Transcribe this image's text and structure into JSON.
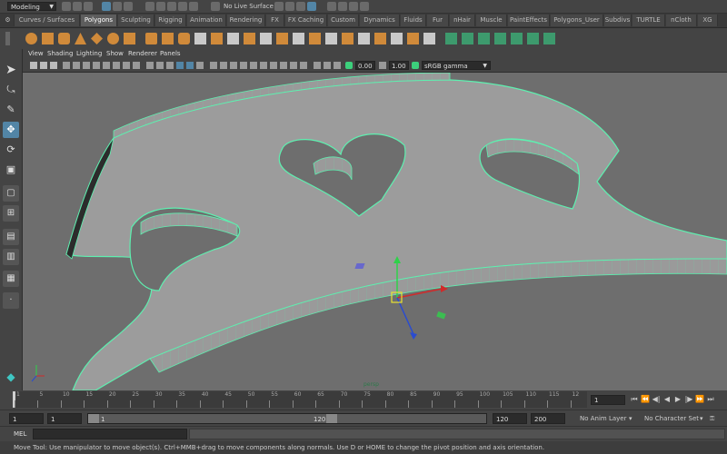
{
  "top": {
    "mode": "Modeling",
    "live_surface": "No Live Surface"
  },
  "shelf": {
    "tabs": [
      "Curves / Surfaces",
      "Polygons",
      "Sculpting",
      "Rigging",
      "Animation",
      "Rendering",
      "FX",
      "FX Caching",
      "Custom",
      "Dynamics",
      "Fluids",
      "Fur",
      "nHair",
      "Muscle",
      "PaintEffects",
      "Polygons_User",
      "Subdivs",
      "TURTLE",
      "nCloth",
      "XG"
    ],
    "active_tab": "Polygons"
  },
  "panel": {
    "menus": [
      "View",
      "Shading",
      "Lighting",
      "Show",
      "Renderer",
      "Panels"
    ],
    "exposure": "0.00",
    "gamma": "1.00",
    "color_space": "sRGB gamma"
  },
  "viewport": {
    "camera_label": "persp"
  },
  "timeline": {
    "ticks": [
      "1",
      "5",
      "10",
      "15",
      "20",
      "25",
      "30",
      "35",
      "40",
      "45",
      "50",
      "55",
      "60",
      "65",
      "70",
      "75",
      "80",
      "85",
      "90",
      "95",
      "100",
      "105",
      "110",
      "115",
      "12"
    ],
    "current_frame": "1"
  },
  "range": {
    "start": "1",
    "playback_start": "1",
    "slider_start": "1",
    "slider_end": "120",
    "playback_end": "120",
    "end": "200",
    "anim_layer": "No Anim Layer",
    "character_set": "No Character Set"
  },
  "mel": {
    "label": "MEL"
  },
  "status": {
    "help": "Move Tool: Use manipulator to move object(s). Ctrl+MMB+drag to move components along normals. Use D or HOME to change the pivot position and axis orientation."
  },
  "colors": {
    "selection_wire": "#5ef0b0",
    "viewport_bg": "#6e6e6e",
    "surface": "#9c9c9c",
    "active_tab": "#5d5d5d",
    "accent": "#5285a6"
  }
}
